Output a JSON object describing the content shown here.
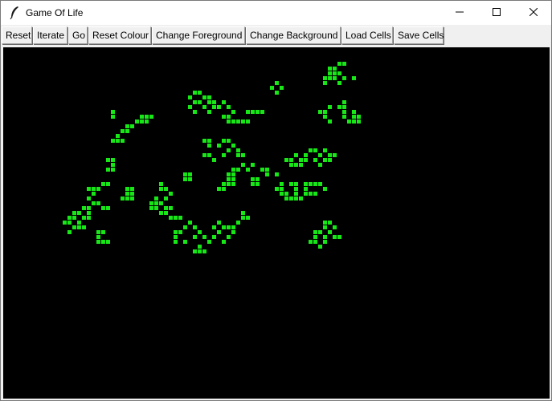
{
  "window": {
    "title": "Game Of Life",
    "app_icon": "feather-icon",
    "controls": {
      "minimize_icon": "minimize-icon",
      "maximize_icon": "maximize-icon",
      "close_icon": "close-icon"
    }
  },
  "toolbar": {
    "reset_label": "Reset",
    "iterate_label": "Iterate",
    "go_label": "Go",
    "reset_colour_label": "Reset Colour",
    "change_foreground_label": "Change Foreground",
    "change_background_label": "Change Background",
    "load_cells_label": "Load Cells",
    "save_cells_label": "Save Cells"
  },
  "board": {
    "background_color": "#000000",
    "foreground_color": "#17e617",
    "cell_size_px": 6,
    "live_cells": [
      [
        69,
        3
      ],
      [
        70,
        3
      ],
      [
        67,
        4
      ],
      [
        68,
        4
      ],
      [
        67,
        5
      ],
      [
        68,
        5
      ],
      [
        69,
        5
      ],
      [
        66,
        6
      ],
      [
        67,
        6
      ],
      [
        68,
        6
      ],
      [
        70,
        6
      ],
      [
        72,
        6
      ],
      [
        66,
        7
      ],
      [
        69,
        7
      ],
      [
        56,
        7
      ],
      [
        55,
        8
      ],
      [
        57,
        8
      ],
      [
        56,
        9
      ],
      [
        39,
        9
      ],
      [
        40,
        9
      ],
      [
        38,
        10
      ],
      [
        41,
        10
      ],
      [
        42,
        10
      ],
      [
        39,
        11
      ],
      [
        40,
        11
      ],
      [
        42,
        11
      ],
      [
        43,
        11
      ],
      [
        45,
        11
      ],
      [
        38,
        12
      ],
      [
        41,
        12
      ],
      [
        43,
        12
      ],
      [
        44,
        12
      ],
      [
        46,
        12
      ],
      [
        39,
        13
      ],
      [
        42,
        13
      ],
      [
        47,
        13
      ],
      [
        50,
        13
      ],
      [
        51,
        13
      ],
      [
        52,
        13
      ],
      [
        45,
        14
      ],
      [
        46,
        14
      ],
      [
        53,
        13
      ],
      [
        46,
        15
      ],
      [
        47,
        15
      ],
      [
        48,
        15
      ],
      [
        49,
        15
      ],
      [
        50,
        15
      ],
      [
        70,
        11
      ],
      [
        67,
        12
      ],
      [
        69,
        12
      ],
      [
        70,
        12
      ],
      [
        65,
        13
      ],
      [
        66,
        13
      ],
      [
        70,
        13
      ],
      [
        72,
        13
      ],
      [
        66,
        14
      ],
      [
        70,
        14
      ],
      [
        72,
        14
      ],
      [
        73,
        14
      ],
      [
        67,
        15
      ],
      [
        71,
        15
      ],
      [
        72,
        15
      ],
      [
        73,
        15
      ],
      [
        22,
        13
      ],
      [
        22,
        14
      ],
      [
        28,
        14
      ],
      [
        29,
        14
      ],
      [
        30,
        14
      ],
      [
        27,
        15
      ],
      [
        28,
        15
      ],
      [
        29,
        15
      ],
      [
        25,
        16
      ],
      [
        26,
        16
      ],
      [
        24,
        17
      ],
      [
        25,
        17
      ],
      [
        23,
        18
      ],
      [
        22,
        19
      ],
      [
        23,
        19
      ],
      [
        24,
        19
      ],
      [
        41,
        19
      ],
      [
        42,
        19
      ],
      [
        45,
        19
      ],
      [
        46,
        19
      ],
      [
        42,
        20
      ],
      [
        44,
        20
      ],
      [
        47,
        20
      ],
      [
        46,
        21
      ],
      [
        48,
        21
      ],
      [
        41,
        22
      ],
      [
        42,
        22
      ],
      [
        45,
        22
      ],
      [
        48,
        22
      ],
      [
        49,
        22
      ],
      [
        63,
        21
      ],
      [
        64,
        21
      ],
      [
        66,
        21
      ],
      [
        60,
        22
      ],
      [
        62,
        22
      ],
      [
        65,
        22
      ],
      [
        67,
        22
      ],
      [
        68,
        22
      ],
      [
        58,
        23
      ],
      [
        59,
        23
      ],
      [
        61,
        23
      ],
      [
        62,
        23
      ],
      [
        64,
        23
      ],
      [
        66,
        23
      ],
      [
        67,
        23
      ],
      [
        59,
        24
      ],
      [
        60,
        24
      ],
      [
        61,
        24
      ],
      [
        65,
        24
      ],
      [
        43,
        23
      ],
      [
        49,
        24
      ],
      [
        51,
        24
      ],
      [
        47,
        25
      ],
      [
        48,
        25
      ],
      [
        50,
        25
      ],
      [
        53,
        25
      ],
      [
        54,
        25
      ],
      [
        54,
        26
      ],
      [
        56,
        26
      ],
      [
        21,
        23
      ],
      [
        22,
        23
      ],
      [
        22,
        24
      ],
      [
        21,
        25
      ],
      [
        22,
        25
      ],
      [
        37,
        26
      ],
      [
        38,
        26
      ],
      [
        37,
        27
      ],
      [
        38,
        27
      ],
      [
        46,
        26
      ],
      [
        47,
        26
      ],
      [
        46,
        27
      ],
      [
        47,
        27
      ],
      [
        51,
        27
      ],
      [
        52,
        27
      ],
      [
        51,
        28
      ],
      [
        52,
        28
      ],
      [
        45,
        28
      ],
      [
        46,
        28
      ],
      [
        47,
        28
      ],
      [
        44,
        29
      ],
      [
        45,
        29
      ],
      [
        20,
        28
      ],
      [
        21,
        28
      ],
      [
        17,
        29
      ],
      [
        18,
        29
      ],
      [
        19,
        29
      ],
      [
        25,
        29
      ],
      [
        26,
        29
      ],
      [
        18,
        30
      ],
      [
        25,
        30
      ],
      [
        26,
        30
      ],
      [
        17,
        31
      ],
      [
        24,
        31
      ],
      [
        25,
        31
      ],
      [
        26,
        31
      ],
      [
        18,
        32
      ],
      [
        19,
        32
      ],
      [
        16,
        33
      ],
      [
        17,
        33
      ],
      [
        20,
        33
      ],
      [
        21,
        33
      ],
      [
        14,
        34
      ],
      [
        15,
        34
      ],
      [
        17,
        34
      ],
      [
        13,
        35
      ],
      [
        14,
        35
      ],
      [
        16,
        35
      ],
      [
        17,
        35
      ],
      [
        12,
        36
      ],
      [
        13,
        36
      ],
      [
        15,
        36
      ],
      [
        14,
        37
      ],
      [
        15,
        37
      ],
      [
        16,
        37
      ],
      [
        13,
        38
      ],
      [
        32,
        28
      ],
      [
        32,
        29
      ],
      [
        33,
        29
      ],
      [
        34,
        30
      ],
      [
        31,
        31
      ],
      [
        33,
        31
      ],
      [
        30,
        32
      ],
      [
        31,
        32
      ],
      [
        32,
        32
      ],
      [
        30,
        33
      ],
      [
        31,
        33
      ],
      [
        33,
        33
      ],
      [
        34,
        33
      ],
      [
        32,
        34
      ],
      [
        33,
        34
      ],
      [
        34,
        35
      ],
      [
        35,
        35
      ],
      [
        36,
        35
      ],
      [
        57,
        28
      ],
      [
        59,
        28
      ],
      [
        60,
        28
      ],
      [
        62,
        28
      ],
      [
        63,
        28
      ],
      [
        64,
        28
      ],
      [
        65,
        28
      ],
      [
        56,
        29
      ],
      [
        57,
        29
      ],
      [
        60,
        29
      ],
      [
        62,
        29
      ],
      [
        66,
        29
      ],
      [
        57,
        30
      ],
      [
        58,
        30
      ],
      [
        60,
        30
      ],
      [
        62,
        30
      ],
      [
        63,
        30
      ],
      [
        64,
        30
      ],
      [
        58,
        31
      ],
      [
        59,
        31
      ],
      [
        60,
        31
      ],
      [
        61,
        31
      ],
      [
        49,
        34
      ],
      [
        49,
        35
      ],
      [
        50,
        35
      ],
      [
        48,
        36
      ],
      [
        66,
        36
      ],
      [
        67,
        36
      ],
      [
        66,
        37
      ],
      [
        68,
        37
      ],
      [
        64,
        38
      ],
      [
        65,
        38
      ],
      [
        67,
        38
      ],
      [
        64,
        39
      ],
      [
        66,
        39
      ],
      [
        68,
        39
      ],
      [
        69,
        39
      ],
      [
        63,
        40
      ],
      [
        64,
        40
      ],
      [
        66,
        40
      ],
      [
        65,
        41
      ],
      [
        38,
        36
      ],
      [
        44,
        36
      ],
      [
        37,
        37
      ],
      [
        39,
        37
      ],
      [
        43,
        37
      ],
      [
        45,
        37
      ],
      [
        46,
        37
      ],
      [
        47,
        37
      ],
      [
        35,
        38
      ],
      [
        36,
        38
      ],
      [
        40,
        38
      ],
      [
        44,
        38
      ],
      [
        47,
        38
      ],
      [
        35,
        39
      ],
      [
        39,
        39
      ],
      [
        41,
        39
      ],
      [
        43,
        39
      ],
      [
        46,
        39
      ],
      [
        35,
        40
      ],
      [
        37,
        40
      ],
      [
        42,
        40
      ],
      [
        45,
        40
      ],
      [
        40,
        41
      ],
      [
        39,
        42
      ],
      [
        40,
        42
      ],
      [
        41,
        42
      ],
      [
        19,
        38
      ],
      [
        20,
        38
      ],
      [
        19,
        39
      ],
      [
        20,
        40
      ],
      [
        19,
        40
      ],
      [
        21,
        40
      ]
    ]
  }
}
